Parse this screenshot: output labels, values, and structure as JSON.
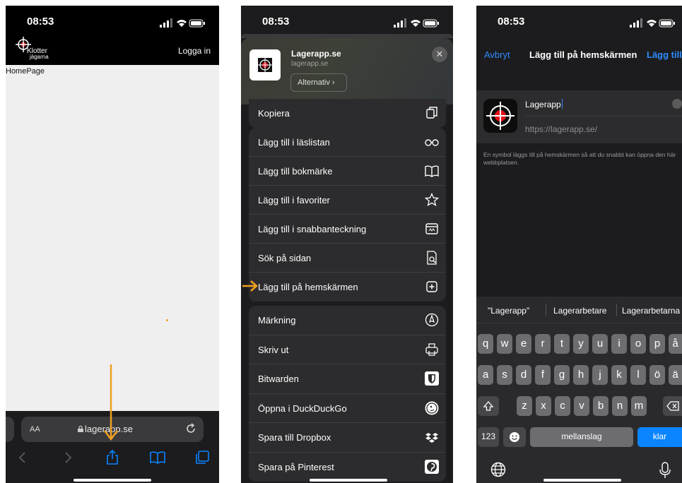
{
  "status": {
    "time": "08:53"
  },
  "phone1": {
    "logo_line1": "Klotter",
    "logo_line2": "jägarna",
    "login": "Logga in",
    "page_label": "HomePage",
    "address_text_size": "AA",
    "address": "lagerapp.se"
  },
  "phone2": {
    "site_name": "Lagerapp.se",
    "site_url": "lagerapp.se",
    "options_label": "Alternativ ›",
    "copy_label": "Kopiera",
    "group1": [
      {
        "label": "Lägg till i läslistan",
        "icon": "glasses-icon"
      },
      {
        "label": "Lägg till bokmärke",
        "icon": "book-icon"
      },
      {
        "label": "Lägg till i favoriter",
        "icon": "star-icon"
      },
      {
        "label": "Lägg till i snabbanteckning",
        "icon": "quick-note-icon"
      },
      {
        "label": "Sök på sidan",
        "icon": "find-in-page-icon"
      },
      {
        "label": "Lägg till på hemskärmen",
        "icon": "add-square-icon"
      }
    ],
    "group2": [
      {
        "label": "Märkning",
        "icon": "markup-pen-icon"
      },
      {
        "label": "Skriv ut",
        "icon": "printer-icon"
      },
      {
        "label": "Bitwarden",
        "icon": "bitwarden-shield-icon"
      },
      {
        "label": "Öppna i DuckDuckGo",
        "icon": "duckduckgo-icon"
      },
      {
        "label": "Spara till Dropbox",
        "icon": "dropbox-icon"
      },
      {
        "label": "Spara på Pinterest",
        "icon": "pinterest-icon"
      }
    ]
  },
  "phone3": {
    "cancel": "Avbryt",
    "title": "Lägg till på hemskärmen",
    "add": "Lägg till",
    "name_value": "Lagerapp",
    "url": "https://lagerapp.se/",
    "description": "En symbol läggs till på hemskärmen så att du snabbt kan öppna den här webbplatsen.",
    "suggestions": [
      "\"Lagerapp\"",
      "Lagerarbetare",
      "Lagerarbetarna"
    ],
    "keys_row1": [
      "q",
      "w",
      "e",
      "r",
      "t",
      "y",
      "u",
      "i",
      "o",
      "p",
      "å"
    ],
    "keys_row2": [
      "a",
      "s",
      "d",
      "f",
      "g",
      "h",
      "j",
      "k",
      "l",
      "ö",
      "ä"
    ],
    "keys_row3": [
      "z",
      "x",
      "c",
      "v",
      "b",
      "n",
      "m"
    ],
    "key_numbers": "123",
    "key_space": "mellanslag",
    "key_done": "klar"
  },
  "colors": {
    "accent_blue": "#2f8cff",
    "arrow_orange": "#f0a020",
    "target_red": "#e0101a"
  }
}
